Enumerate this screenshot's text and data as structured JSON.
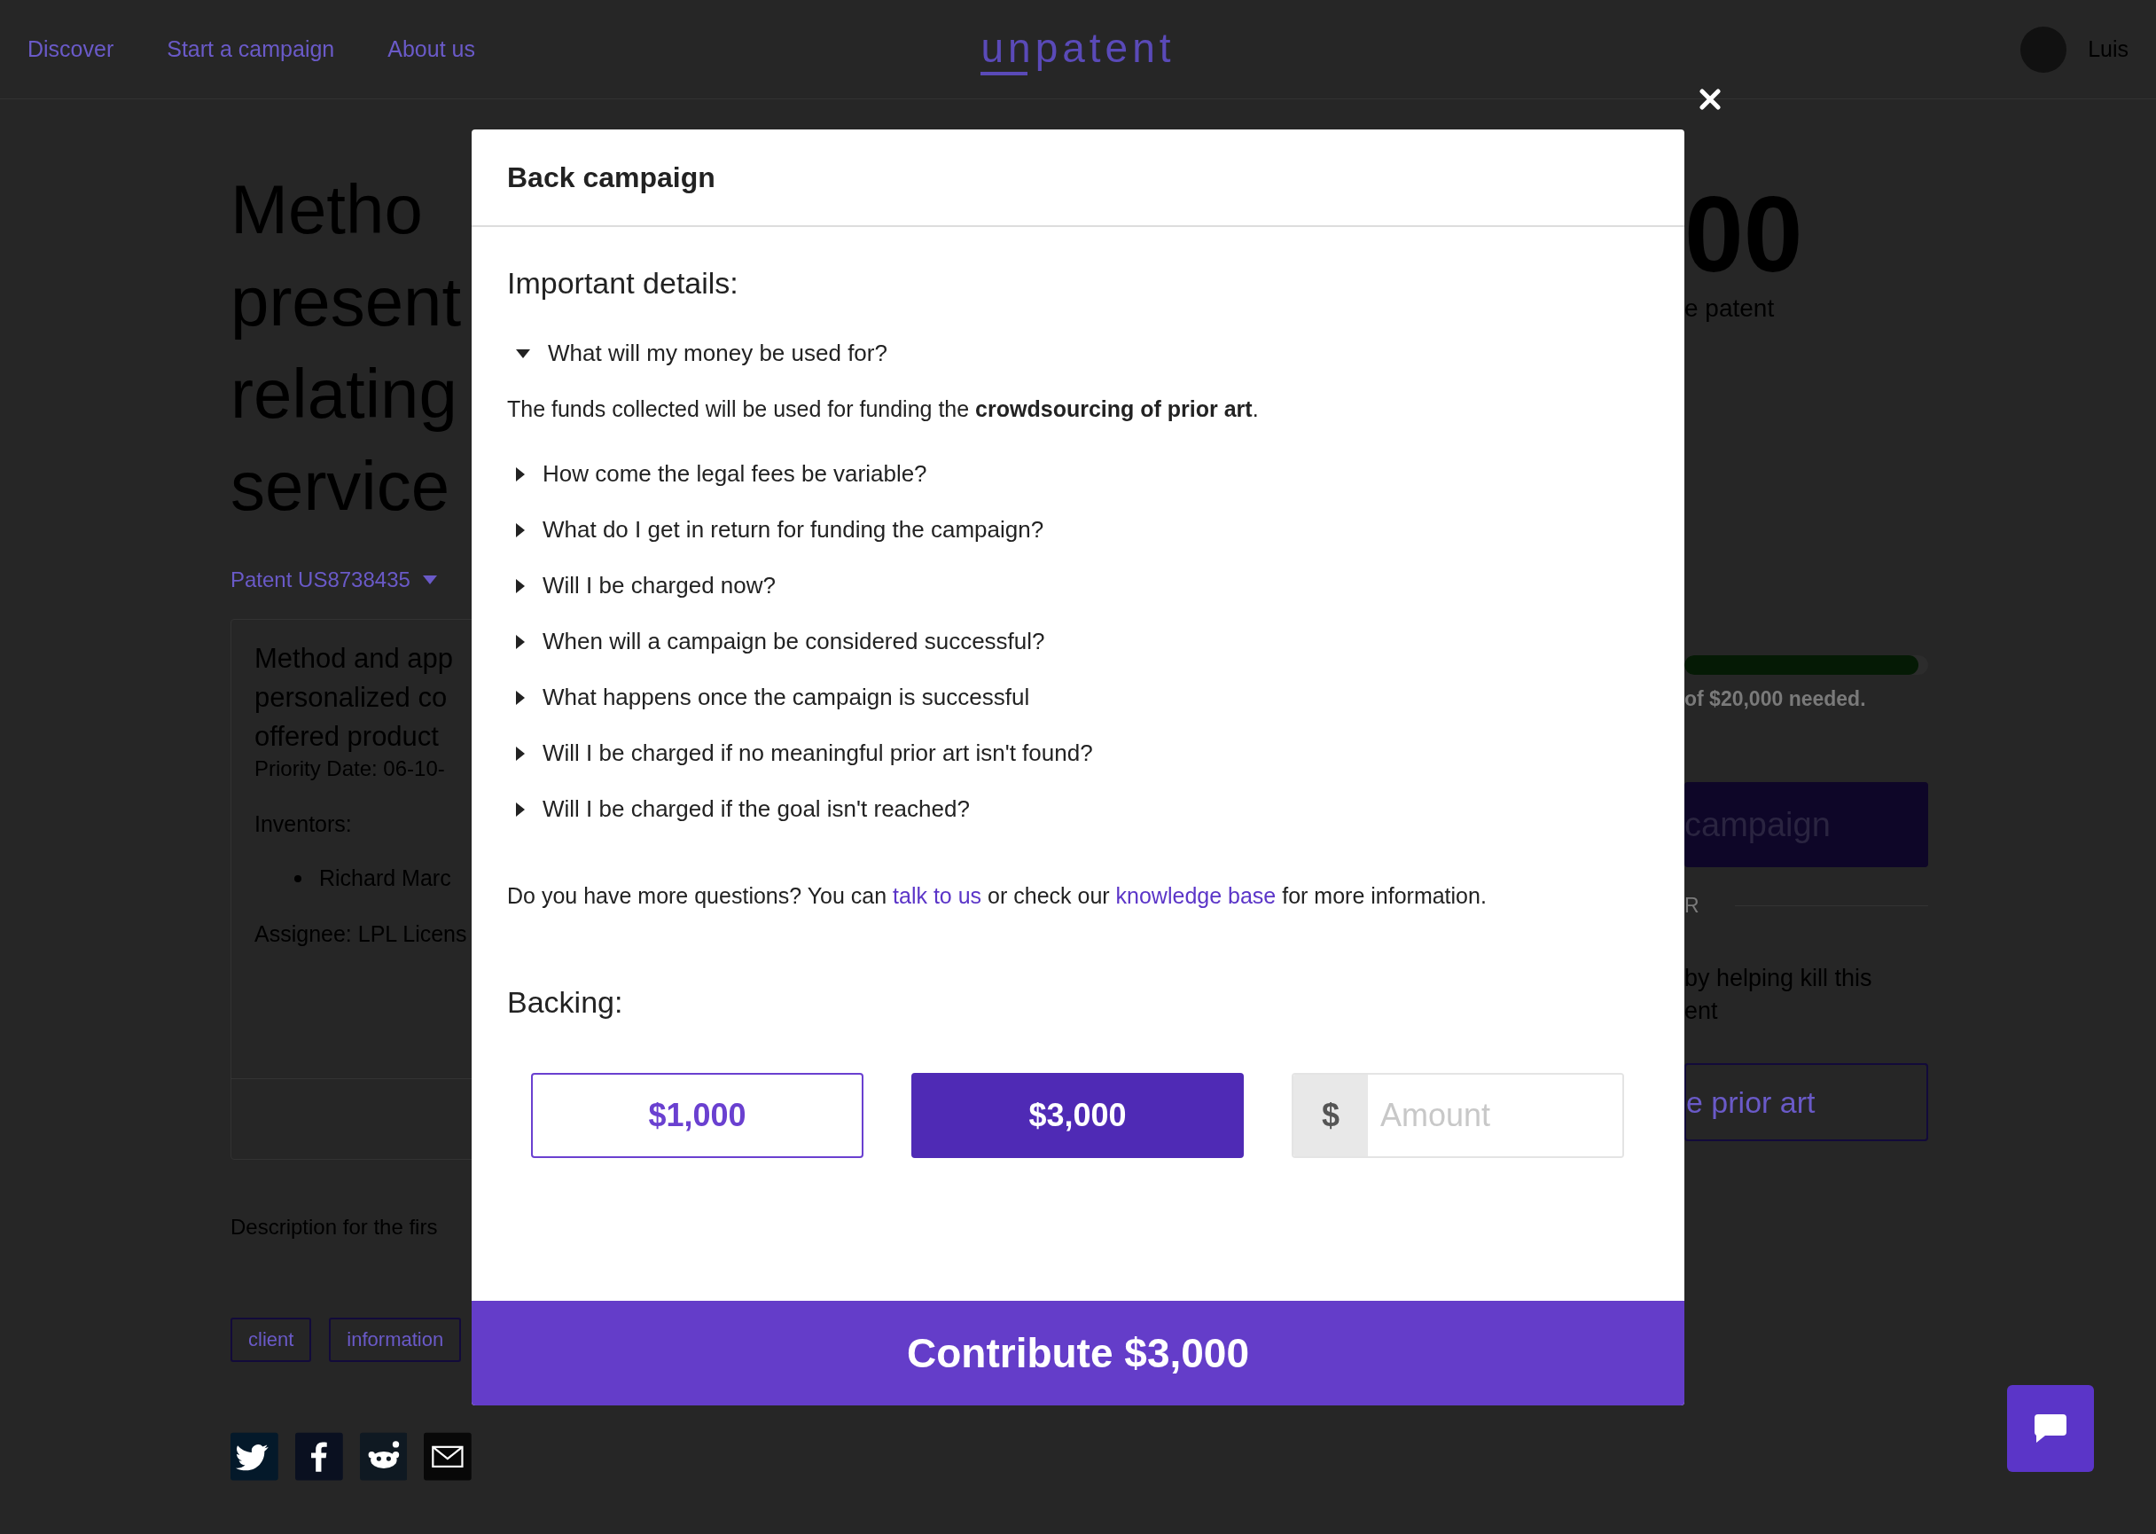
{
  "nav": {
    "links": [
      "Discover",
      "Start a campaign",
      "About us"
    ],
    "logo": "unpatent",
    "user": "Luis"
  },
  "page": {
    "title_lines": [
      "Metho",
      "present",
      "relating",
      "service"
    ],
    "patent_link": "Patent US8738435",
    "card": {
      "title_lines": [
        "Method and app",
        "personalized co",
        "offered product"
      ],
      "priority": "Priority Date: 06-10-",
      "inventors_label": "Inventors:",
      "inventors": [
        "Richard Marc"
      ],
      "assignee": "Assignee: LPL Licens"
    },
    "description": "Description for the firs",
    "tags": [
      "client",
      "information"
    ]
  },
  "sidebar": {
    "amount": "00",
    "amount_caption": "e patent",
    "progress": {
      "level": 0.96
    },
    "progress_text": "of $20,000 needed.",
    "primary_button": "campaign",
    "divider_text": "R",
    "note_lines": [
      "by helping kill this",
      "ent"
    ],
    "secondary_button": "e prior art"
  },
  "modal": {
    "title": "Back campaign",
    "details_heading": "Important details:",
    "faq": [
      {
        "question": "What will my money be used for?",
        "expanded": true,
        "answer": "The funds collected will be used for funding the **crowdsourcing of prior art**."
      },
      {
        "question": "How come the legal fees be variable?",
        "expanded": false
      },
      {
        "question": "What do I get in return for funding the campaign?",
        "expanded": false
      },
      {
        "question": "Will I be charged now?",
        "expanded": false
      },
      {
        "question": "When will a campaign be considered successful?",
        "expanded": false
      },
      {
        "question": "What happens once the campaign is successful",
        "expanded": false
      },
      {
        "question": "Will I be charged if no meaningful prior art isn't found?",
        "expanded": false
      },
      {
        "question": "Will I be charged if the goal isn't reached?",
        "expanded": false
      }
    ],
    "more": {
      "before": "Do you have more questions? You can",
      "link1": "talk to us",
      "middle": "or check our",
      "link2": "knowledge base",
      "after": "for more information."
    },
    "backing_heading": "Backing:",
    "amounts": [
      {
        "label": "$1,000",
        "selected": false
      },
      {
        "label": "$3,000",
        "selected": true
      }
    ],
    "custom_amount": {
      "prefix": "$",
      "placeholder": "Amount"
    },
    "submit": "Contribute $3,000"
  }
}
